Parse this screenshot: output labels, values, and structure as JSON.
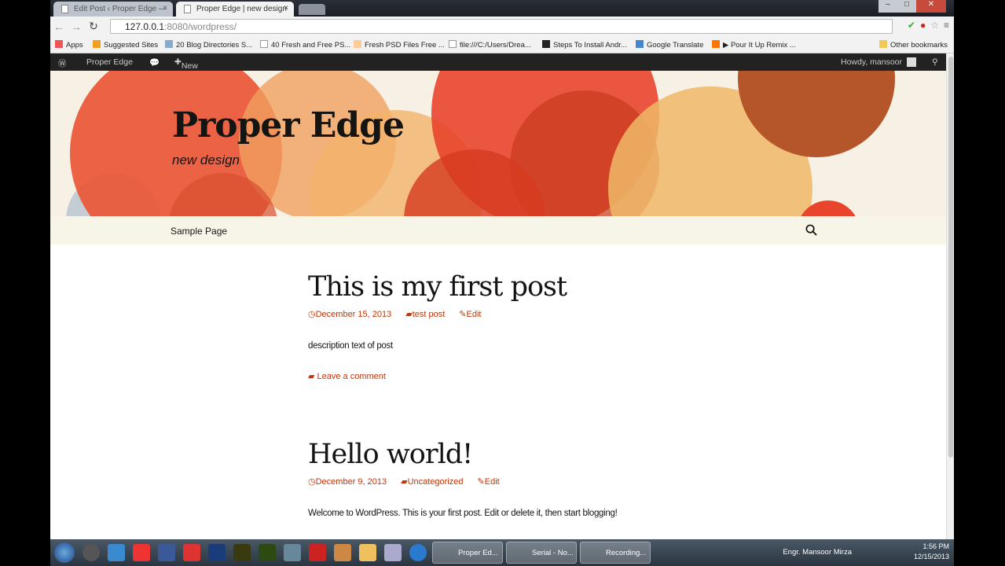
{
  "browser": {
    "tabs": [
      {
        "label": "Edit Post ‹ Proper Edge —"
      },
      {
        "label": "Proper Edge | new design"
      }
    ],
    "url_host": "127.0.0.1",
    "url_rest": ":8080/wordpress/",
    "bookmarks": [
      "Apps",
      "Suggested Sites",
      "20 Blog Directories S...",
      "40 Fresh and Free PS...",
      "Fresh PSD Files Free ...",
      "file:///C:/Users/Drea...",
      "Steps To Install Andr...",
      "Google Translate",
      "▶ Pour It Up Remix ..."
    ],
    "other_bookmarks": "Other bookmarks"
  },
  "adminbar": {
    "site": "Proper Edge",
    "new": "New",
    "howdy": "Howdy, mansoor"
  },
  "site": {
    "title": "Proper Edge",
    "description": "new design",
    "nav": [
      "Sample Page"
    ]
  },
  "posts": [
    {
      "title": "This is my first post",
      "date": "December 15, 2013",
      "category": "test post",
      "edit": "Edit",
      "content": "description text of post",
      "comment": "Leave a comment"
    },
    {
      "title": "Hello world!",
      "date": "December 9, 2013",
      "category": "Uncategorized",
      "edit": "Edit",
      "content": "Welcome to WordPress. This is your first post. Edit or delete it, then start blogging!"
    }
  ],
  "taskbar": {
    "windows": [
      "Proper Ed...",
      "Serial - No...",
      "Recording..."
    ],
    "user": "Engr. Mansoor Mirza",
    "time": "1:56 PM",
    "date": "12/15/2013"
  },
  "colors": {
    "accent": "#bc360a",
    "adminbar": "#222222"
  }
}
